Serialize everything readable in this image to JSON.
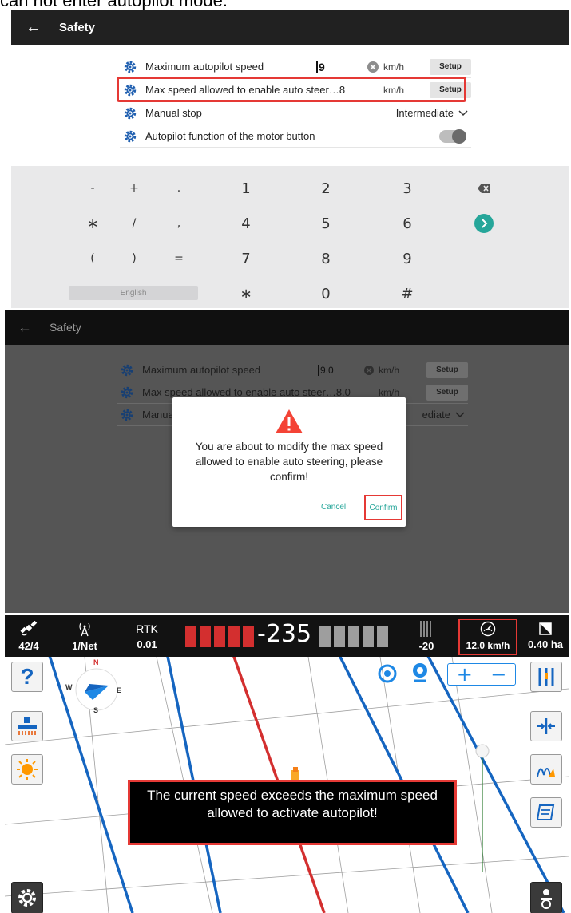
{
  "caption": {
    "text": "can not enter autopilot mode."
  },
  "panel1": {
    "title": "Safety",
    "rows": [
      {
        "label": "Maximum autopilot speed",
        "value": "9",
        "unit": "km/h",
        "button": "Setup"
      },
      {
        "label": "Max speed allowed to enable auto steer…8",
        "unit": "km/h",
        "button": "Setup"
      },
      {
        "label": "Manual stop",
        "select": "Intermediate"
      },
      {
        "label": "Autopilot function of the motor button",
        "toggle": "off"
      }
    ],
    "keypad": {
      "row1": [
        "-",
        "+",
        ".",
        "1",
        "2",
        "3"
      ],
      "row2": [
        "∗",
        "/",
        ",",
        "4",
        "5",
        "6"
      ],
      "row3": [
        "(",
        ")",
        "=",
        "7",
        "8",
        "9"
      ],
      "row4": [
        "∗",
        "0",
        "#"
      ],
      "language": "English"
    }
  },
  "panel2": {
    "title": "Safety",
    "rows": [
      {
        "label": "Maximum autopilot speed",
        "value": "9.0",
        "unit": "km/h",
        "button": "Setup"
      },
      {
        "label": "Max speed allowed to enable auto steer…8.0",
        "unit": "km/h",
        "button": "Setup"
      },
      {
        "label": "Manua",
        "select": "ediate"
      }
    ],
    "dialog": {
      "message": "You are about to modify the max speed allowed to enable auto steering, please confirm!",
      "cancel": "Cancel",
      "confirm": "Confirm"
    }
  },
  "panel3": {
    "status": {
      "satellites": "42/4",
      "network": "1/Net",
      "rtk_label": "RTK",
      "rtk_value": "0.01",
      "offset": "-235",
      "heading_offset": "-20",
      "speed": "12.0 km/h",
      "area": "0.40 ha"
    },
    "compass": {
      "n": "N",
      "s": "S",
      "e": "E",
      "w": "W"
    },
    "toast": "The current speed exceeds the maximum speed allowed to activate autopilot!",
    "colors": {
      "accent_red": "#e53935",
      "guide_blue": "#1565c0",
      "guide_red": "#d32f2f"
    }
  }
}
